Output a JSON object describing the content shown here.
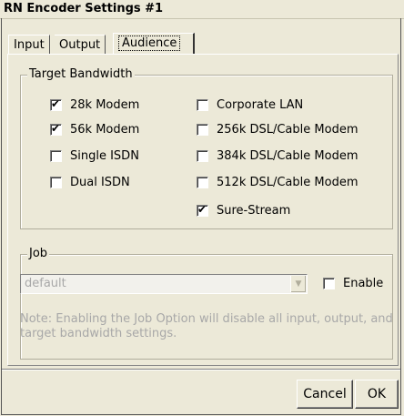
{
  "window": {
    "title": "RN Encoder Settings #1"
  },
  "tabs": [
    {
      "label": "Input"
    },
    {
      "label": "Output"
    },
    {
      "label": "Audience",
      "active": true
    }
  ],
  "target_bandwidth": {
    "legend": "Target Bandwidth",
    "options": [
      {
        "label": "28k Modem",
        "checked": true
      },
      {
        "label": "56k Modem",
        "checked": true
      },
      {
        "label": "Single ISDN",
        "checked": false
      },
      {
        "label": "Dual ISDN",
        "checked": false
      },
      {
        "label": "Corporate LAN",
        "checked": false
      },
      {
        "label": "256k DSL/Cable Modem",
        "checked": false
      },
      {
        "label": "384k DSL/Cable Modem",
        "checked": false
      },
      {
        "label": "512k DSL/Cable Modem",
        "checked": false
      },
      {
        "label": "Sure-Stream",
        "checked": true
      }
    ]
  },
  "job": {
    "legend": "Job",
    "select_value": "default",
    "enable_label": "Enable",
    "enable_checked": false,
    "note": "Note: Enabling the Job Option will disable all input, output, and target bandwidth settings."
  },
  "buttons": {
    "cancel": "Cancel",
    "ok": "OK"
  },
  "checkmark_glyph": "✔"
}
